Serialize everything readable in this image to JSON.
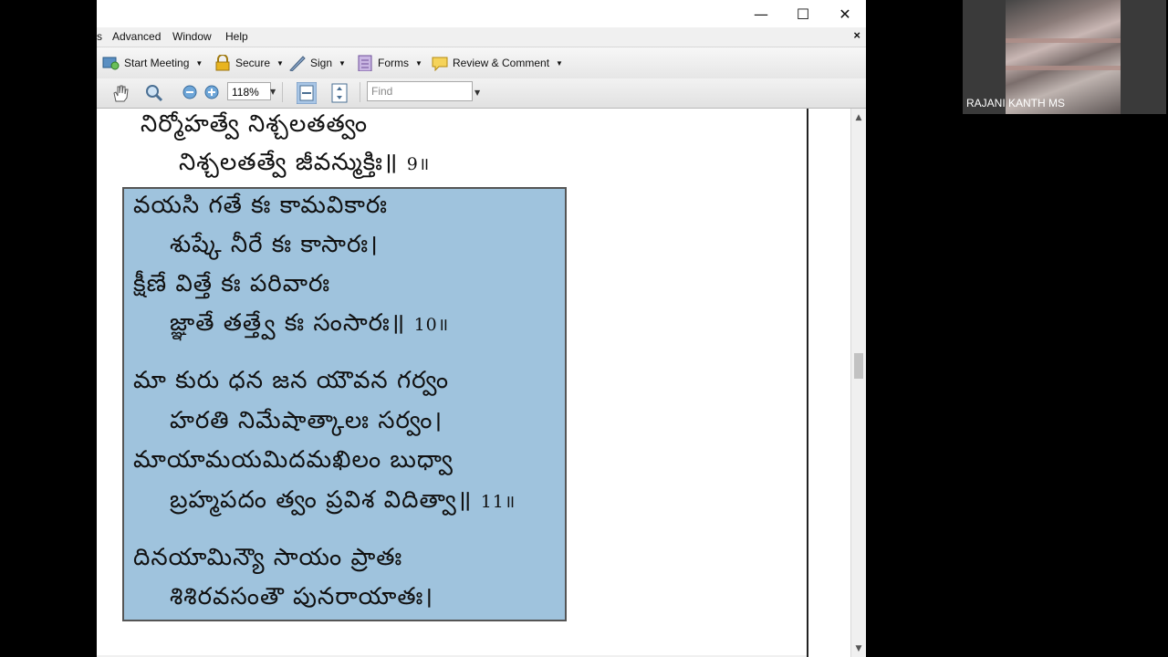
{
  "window": {
    "minimize": "—",
    "maximize": "☐",
    "close": "✕"
  },
  "menu": {
    "clip": "s",
    "advanced": "Advanced",
    "window": "Window",
    "help": "Help",
    "close_doc": "×"
  },
  "tasks": [
    {
      "label": "Start Meeting",
      "icon": "meeting-icon"
    },
    {
      "label": "Secure",
      "icon": "lock-icon"
    },
    {
      "label": "Sign",
      "icon": "pen-icon"
    },
    {
      "label": "Forms",
      "icon": "form-icon"
    },
    {
      "label": "Review & Comment",
      "icon": "comment-icon"
    }
  ],
  "toolbar": {
    "zoom": "118%",
    "find_placeholder": "Find"
  },
  "verse": {
    "lines": [
      "నిర్మోహత్వే నిశ్చలతత్వం",
      "నిశ్చలతత్వే జీవన్ముక్తిః॥ ",
      "వయసి గతే కః కామవికారః",
      "శుష్కే నీరే కః కాసారః।",
      "క్షీణే విత్తే కః పరివారః",
      "జ్ఞాతే తత్త్వే కః సంసారః॥ ",
      "మా కురు ధన జన యౌవన గర్వం",
      "హరతి నిమేషాత్కాలః సర్వం।",
      "మాయామయమిదమఖిలం బుధ్వా",
      "బ్రహ్మపదం త్వం ప్రవిశ విదిత్వా॥ ",
      "దినయామిన్యౌ సాయం ప్రాతః",
      "శిశిరవసంతౌ పునరాయాతః।"
    ],
    "n9": "9॥",
    "n10": "10॥",
    "n11": "11॥"
  },
  "participant": {
    "name": "RAJANI KANTH MS"
  }
}
